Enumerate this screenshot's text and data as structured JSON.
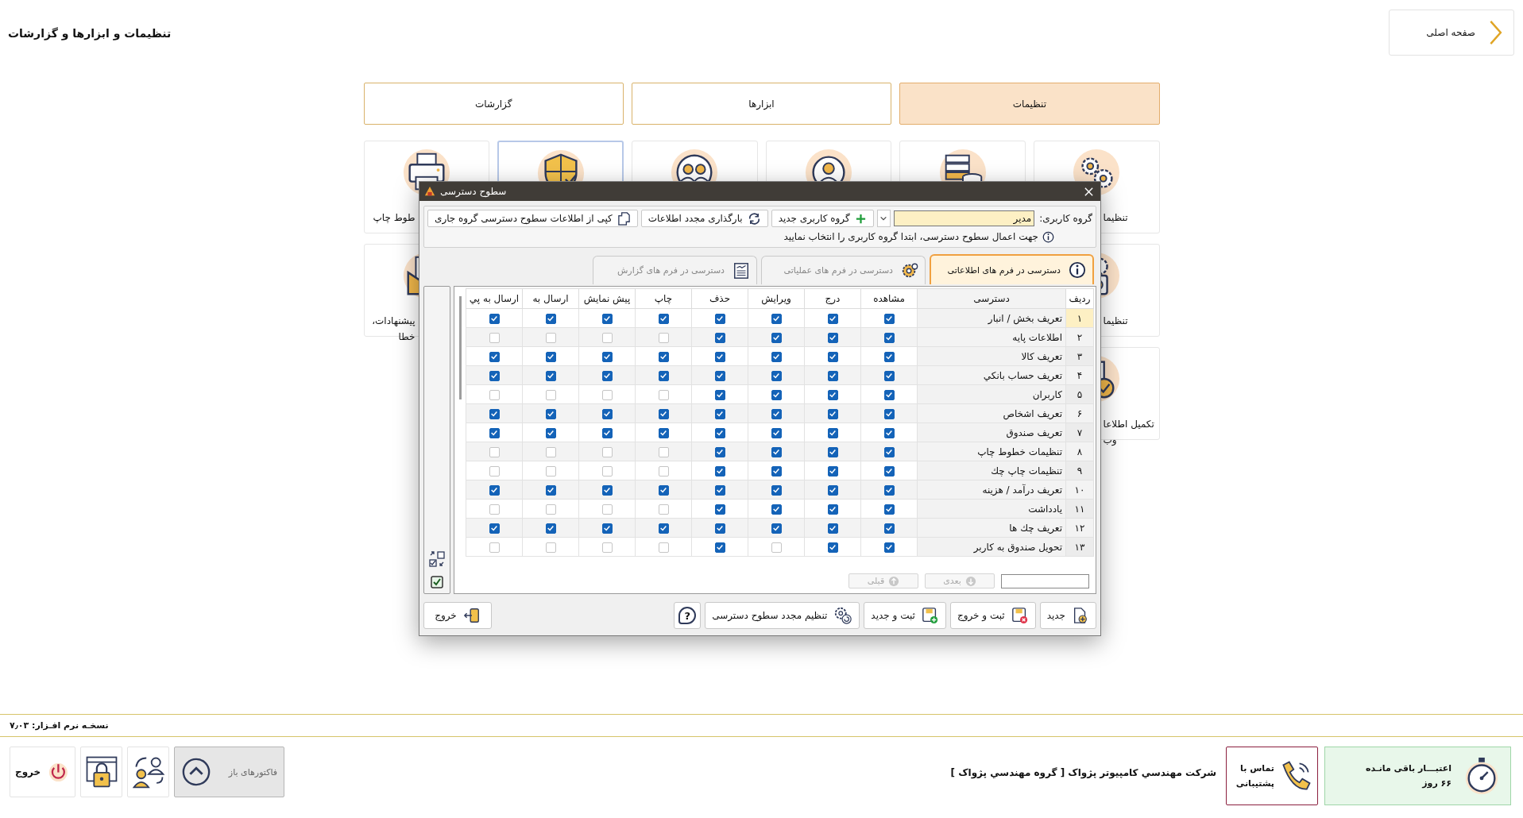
{
  "header": {
    "title": "تنظیمات و ابزارها و گزارشات",
    "home_button": "صفحه اصلی"
  },
  "tabs": [
    {
      "label": "تنظیمات",
      "selected": true
    },
    {
      "label": "ابزارها",
      "selected": false
    },
    {
      "label": "گزارشات",
      "selected": false
    }
  ],
  "card_rows": [
    {
      "cards": [
        {
          "lines": [
            "تنظیما"
          ],
          "selected": false
        },
        {
          "selected": false
        },
        {
          "selected": false
        },
        {
          "selected": false
        },
        {
          "selected": true
        },
        {
          "lines": [
            "طوط چاپ"
          ],
          "selected": false
        }
      ]
    },
    {
      "cards": [
        {
          "lines": [
            "تنظیما"
          ],
          "selected": false
        },
        {
          "lines": [
            "پیشنهادات،",
            "خطا"
          ],
          "selected": false
        }
      ]
    },
    {
      "cards": [
        {
          "lines": [
            "تکمیل اطلاعا",
            "وب"
          ],
          "selected": false
        }
      ]
    }
  ],
  "dialog": {
    "title": "سطوح دسترسی",
    "group_label": "گروه کاربری:",
    "group_value": "مدیر",
    "toolbar_buttons": [
      {
        "kind": "add",
        "label": "گروه کاربری جدید"
      },
      {
        "kind": "reload",
        "label": "بارگذاری مجدد اطلاعات"
      },
      {
        "kind": "copy",
        "label": "کپی از اطلاعات سطوح دسترسی گروه جاری"
      }
    ],
    "info": "جهت اعمال سطوح دسترسی، ابتدا گروه کاربری را انتخاب نمایید",
    "tabs": [
      {
        "label": "دسترسی در فرم های اطلاعاتی",
        "selected": true
      },
      {
        "label": "دسترسی در فرم های عملیاتی",
        "selected": false
      },
      {
        "label": "دسترسی در فرم های گزارش",
        "selected": false
      }
    ],
    "table": {
      "columns": [
        "ردیف",
        "دسترسی",
        "مشاهده",
        "درج",
        "ویرایش",
        "حذف",
        "چاپ",
        "پیش نمایش",
        "ارسال به",
        "ارسال به پي"
      ],
      "rows": [
        {
          "index": "۱",
          "name": "تعریف بخش / انبار",
          "selected": true,
          "checks": [
            true,
            true,
            true,
            true,
            true,
            true,
            true,
            true
          ]
        },
        {
          "index": "۲",
          "name": "اطلاعات پایه",
          "selected": false,
          "checks": [
            true,
            true,
            true,
            true,
            false,
            false,
            false,
            false
          ]
        },
        {
          "index": "۳",
          "name": "تعریف کالا",
          "selected": false,
          "checks": [
            true,
            true,
            true,
            true,
            true,
            true,
            true,
            true
          ]
        },
        {
          "index": "۴",
          "name": "تعریف حساب بانکي",
          "selected": false,
          "checks": [
            true,
            true,
            true,
            true,
            true,
            true,
            true,
            true
          ]
        },
        {
          "index": "۵",
          "name": "کاربران",
          "selected": false,
          "checks": [
            true,
            true,
            true,
            true,
            false,
            false,
            false,
            false
          ]
        },
        {
          "index": "۶",
          "name": "تعریف اشخاص",
          "selected": false,
          "checks": [
            true,
            true,
            true,
            true,
            true,
            true,
            true,
            true
          ]
        },
        {
          "index": "۷",
          "name": "تعریف صندوق",
          "selected": false,
          "checks": [
            true,
            true,
            true,
            true,
            true,
            true,
            true,
            true
          ]
        },
        {
          "index": "۸",
          "name": "تنظیمات خطوط چاپ",
          "selected": false,
          "checks": [
            true,
            true,
            true,
            true,
            false,
            false,
            false,
            false
          ]
        },
        {
          "index": "۹",
          "name": "تنظیمات چاپ چك",
          "selected": false,
          "checks": [
            true,
            true,
            true,
            true,
            false,
            false,
            false,
            false
          ]
        },
        {
          "index": "۱۰",
          "name": "تعریف درآمد / هزینه",
          "selected": false,
          "checks": [
            true,
            true,
            true,
            true,
            true,
            true,
            true,
            true
          ]
        },
        {
          "index": "۱۱",
          "name": "یادداشت",
          "selected": false,
          "checks": [
            true,
            true,
            true,
            true,
            false,
            false,
            false,
            false
          ]
        },
        {
          "index": "۱۲",
          "name": "تعریف چك ها",
          "selected": false,
          "checks": [
            true,
            true,
            true,
            true,
            true,
            true,
            true,
            true
          ]
        },
        {
          "index": "۱۳",
          "name": "تحویل صندوق به کاربر",
          "selected": false,
          "checks": [
            true,
            true,
            false,
            true,
            false,
            false,
            false,
            false
          ]
        }
      ]
    },
    "select_all": {
      "checked": true
    },
    "pager": [
      {
        "kind": "next",
        "label": "بعدی",
        "disabled": true
      },
      {
        "kind": "previous",
        "label": "قبلی",
        "disabled": true
      }
    ],
    "buttons": [
      {
        "kind": "new",
        "label": "جدید"
      },
      {
        "kind": "save-exit",
        "label": "ثبت و خروج"
      },
      {
        "kind": "save-new",
        "label": "ثبت و جدید"
      },
      {
        "kind": "reset",
        "label": "تنظیم مجدد سطوح دسترسی"
      },
      {
        "kind": "help",
        "label": "?"
      },
      {
        "kind": "exit",
        "label": "خروج"
      }
    ]
  },
  "version": "نسخـه نرم افـزار: ۷٫۰۳",
  "bottom_bar": {
    "credit": {
      "title": "اعتبـــار باقی مانـده",
      "value": "۶۶ روز"
    },
    "support": [
      "تماس با",
      "پشتیبانی"
    ],
    "company": "شرکت مهندسي کامپيوتر پژواک [ گروه مهندسي پژواک ]",
    "open_invoices": "فاکتورهای باز",
    "exit": "خروج"
  }
}
